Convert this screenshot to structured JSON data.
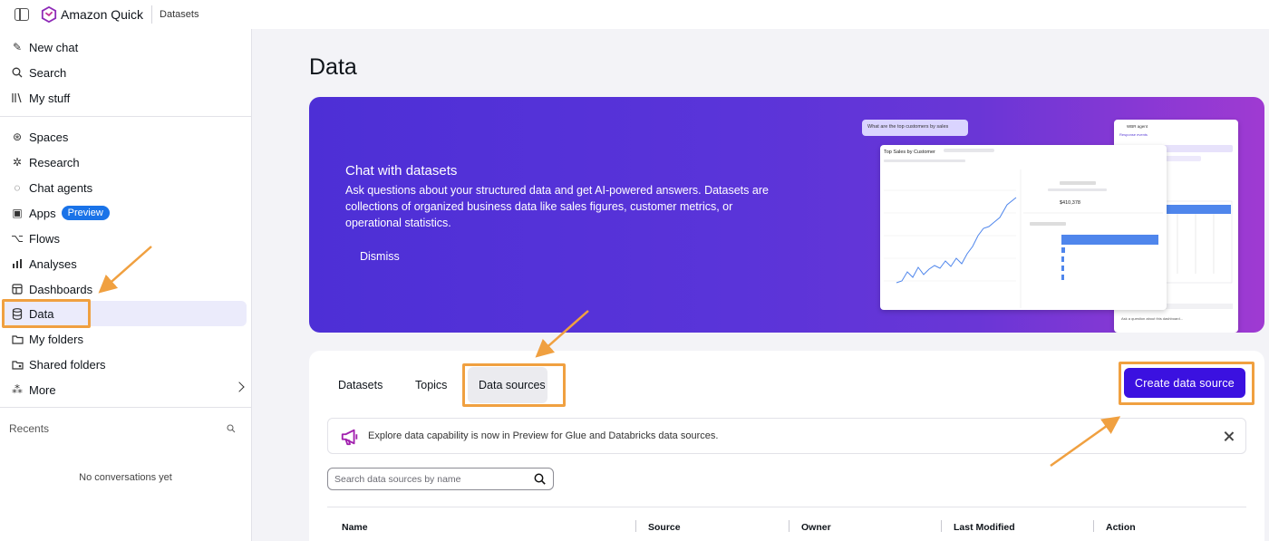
{
  "topbar": {
    "app_name": "Amazon Quick",
    "breadcrumb": "Datasets"
  },
  "sidebar": {
    "items": [
      {
        "label": "New chat",
        "icon": "edit-icon"
      },
      {
        "label": "Search",
        "icon": "search-icon"
      },
      {
        "label": "My stuff",
        "icon": "library-icon"
      },
      {
        "label": "Spaces",
        "icon": "spaces-icon"
      },
      {
        "label": "Research",
        "icon": "research-icon"
      },
      {
        "label": "Chat agents",
        "icon": "chat-agent-icon"
      },
      {
        "label": "Apps",
        "icon": "apps-icon",
        "badge": "Preview"
      },
      {
        "label": "Flows",
        "icon": "flows-icon"
      },
      {
        "label": "Analyses",
        "icon": "analyses-icon"
      },
      {
        "label": "Dashboards",
        "icon": "dashboard-icon"
      },
      {
        "label": "Data",
        "icon": "database-icon",
        "active": true
      },
      {
        "label": "My folders",
        "icon": "folder-icon"
      },
      {
        "label": "Shared folders",
        "icon": "shared-folder-icon"
      },
      {
        "label": "More",
        "icon": "more-icon"
      }
    ],
    "recents_label": "Recents",
    "empty_text": "No conversations yet"
  },
  "main": {
    "title": "Data",
    "hero": {
      "title": "Chat with datasets",
      "description": "Ask questions about your structured data and get AI-powered answers. Datasets are collections of organized business data like sales figures, customer metrics, or operational statistics.",
      "dismiss": "Dismiss",
      "mock": {
        "question": "What are the top customers by sales",
        "chart_title": "Top Sales by Customer",
        "kpi_value": "$410,378",
        "side_title": "WBR agent",
        "side_sub": "Response events",
        "ask_placeholder": "Ask a question about this dashboard..."
      }
    },
    "tabs": [
      {
        "label": "Datasets"
      },
      {
        "label": "Topics"
      },
      {
        "label": "Data sources",
        "active": true
      }
    ],
    "create_button": "Create data source",
    "notice": {
      "text": "Explore data capability is now in Preview for Glue and Databricks data sources.",
      "icon": "megaphone-icon"
    },
    "search": {
      "placeholder": "Search data sources by name"
    },
    "table": {
      "columns": [
        "Name",
        "Source",
        "Owner",
        "Last Modified",
        "Action"
      ]
    }
  },
  "colors": {
    "accent": "#3b11e0",
    "annotation": "#f0a040",
    "hero_start": "#4d2fd6",
    "hero_end": "#9f3ad2",
    "preview_badge": "#1a73e8"
  }
}
